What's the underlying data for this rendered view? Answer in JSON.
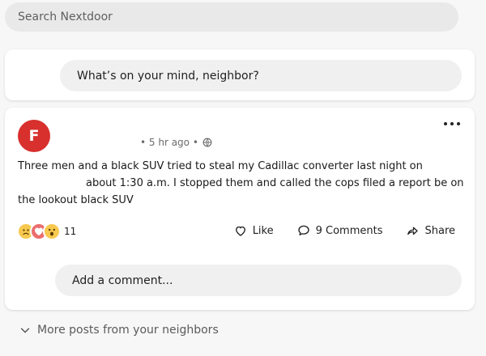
{
  "search": {
    "placeholder": "Search Nextdoor"
  },
  "composer": {
    "placeholder": "What’s on your mind, neighbor?"
  },
  "post": {
    "author_initial": "F",
    "meta": "• 5 hr ago •",
    "text_lines": [
      "Three men and a black SUV tried to steal my Cadillac converter last night on",
      "about 1:30 a.m. I stopped them and called the cops filed a report be on",
      "the lookout black SUV"
    ],
    "reactions": {
      "icons": [
        "sad-face",
        "heart",
        "wow-face"
      ],
      "count": "11"
    },
    "actions": {
      "like": "Like",
      "comments": "9 Comments",
      "share": "Share"
    }
  },
  "comment_box": {
    "placeholder": "Add a comment..."
  },
  "footer": {
    "more_posts": "More posts from your neighbors"
  },
  "colors": {
    "avatar": "#d7302d",
    "page_bg": "#f7f7f7",
    "card_bg": "#ffffff",
    "pill_bg": "#f0f0f0"
  }
}
